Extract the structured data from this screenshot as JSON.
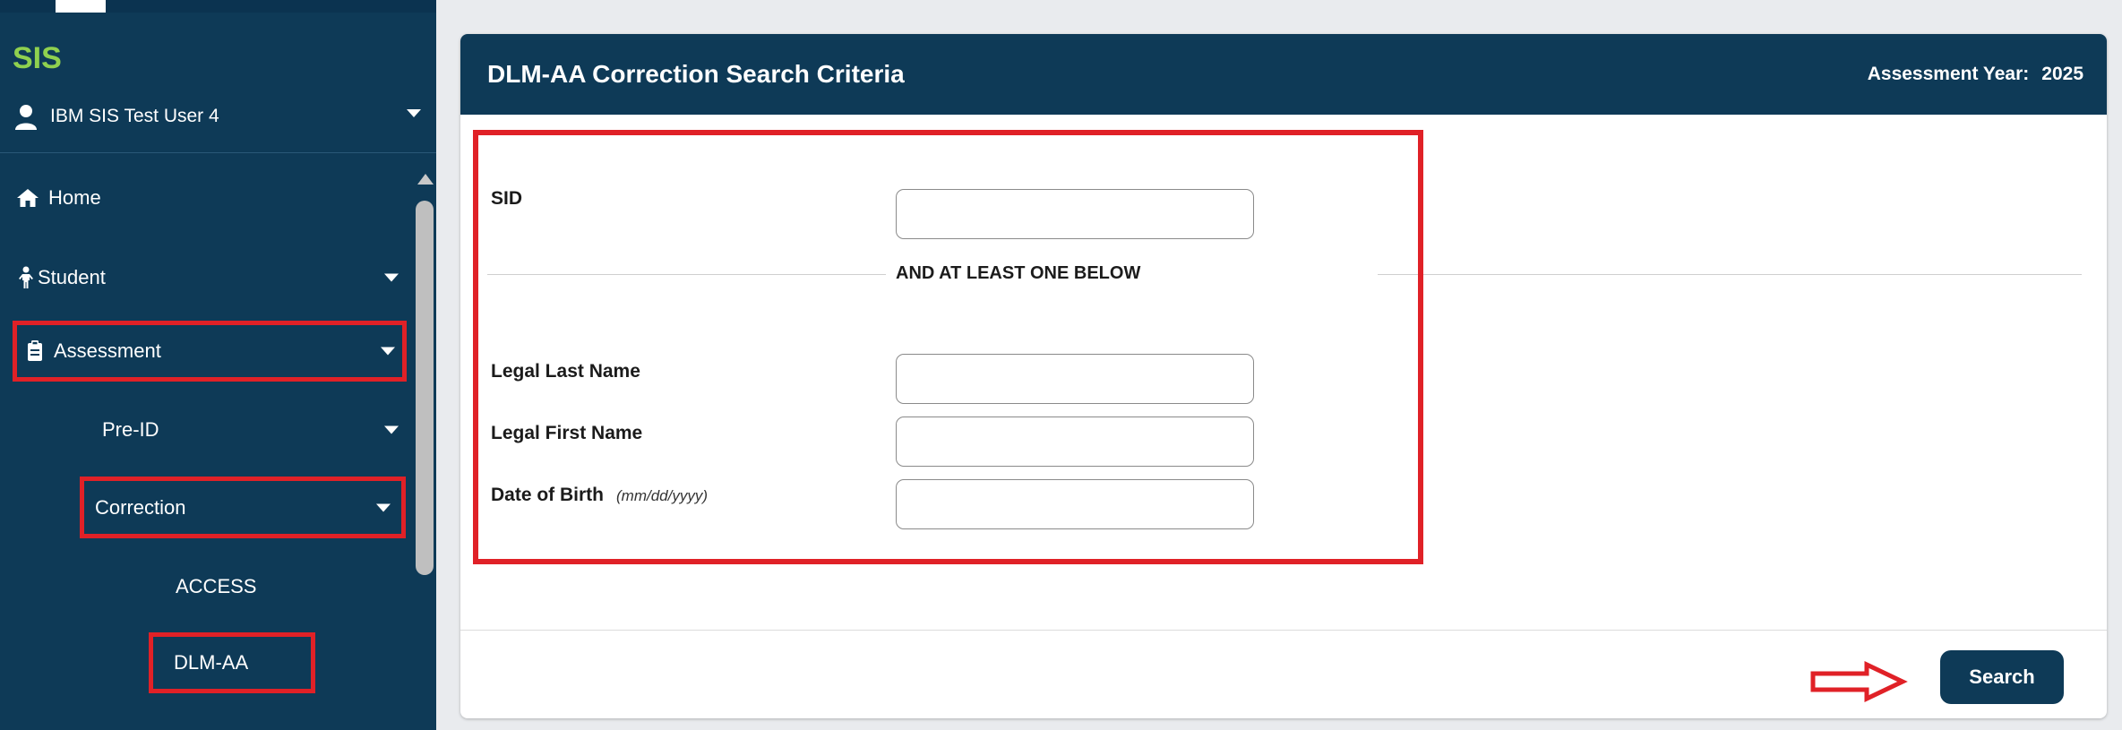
{
  "sidebar": {
    "app_title": "SIS",
    "user_name": "IBM SIS Test User 4",
    "items": {
      "home": {
        "label": "Home",
        "icon": "home-icon"
      },
      "student": {
        "label": "Student",
        "icon": "person-icon"
      },
      "assessment": {
        "label": "Assessment",
        "icon": "clipboard-icon"
      },
      "preid": {
        "label": "Pre-ID"
      },
      "correction": {
        "label": "Correction"
      },
      "access": {
        "label": "ACCESS"
      },
      "dlmaa": {
        "label": "DLM-AA"
      }
    }
  },
  "panel": {
    "title": "DLM-AA Correction Search Criteria",
    "assessment_year_label": "Assessment Year:",
    "assessment_year_value": "2025",
    "sid_label": "SID",
    "divider_text": "AND AT LEAST ONE BELOW",
    "legal_last_name_label": "Legal Last Name",
    "legal_first_name_label": "Legal First Name",
    "dob_label": "Date of Birth",
    "dob_hint": "(mm/dd/yyyy)",
    "fields": {
      "sid": "",
      "legal_last_name": "",
      "legal_first_name": "",
      "dob": ""
    },
    "search_label": "Search"
  },
  "colors": {
    "sidebar_bg": "#0e3a57",
    "accent_green": "#8fd14f",
    "highlight_red": "#e02127",
    "page_bg": "#e9ebee"
  }
}
